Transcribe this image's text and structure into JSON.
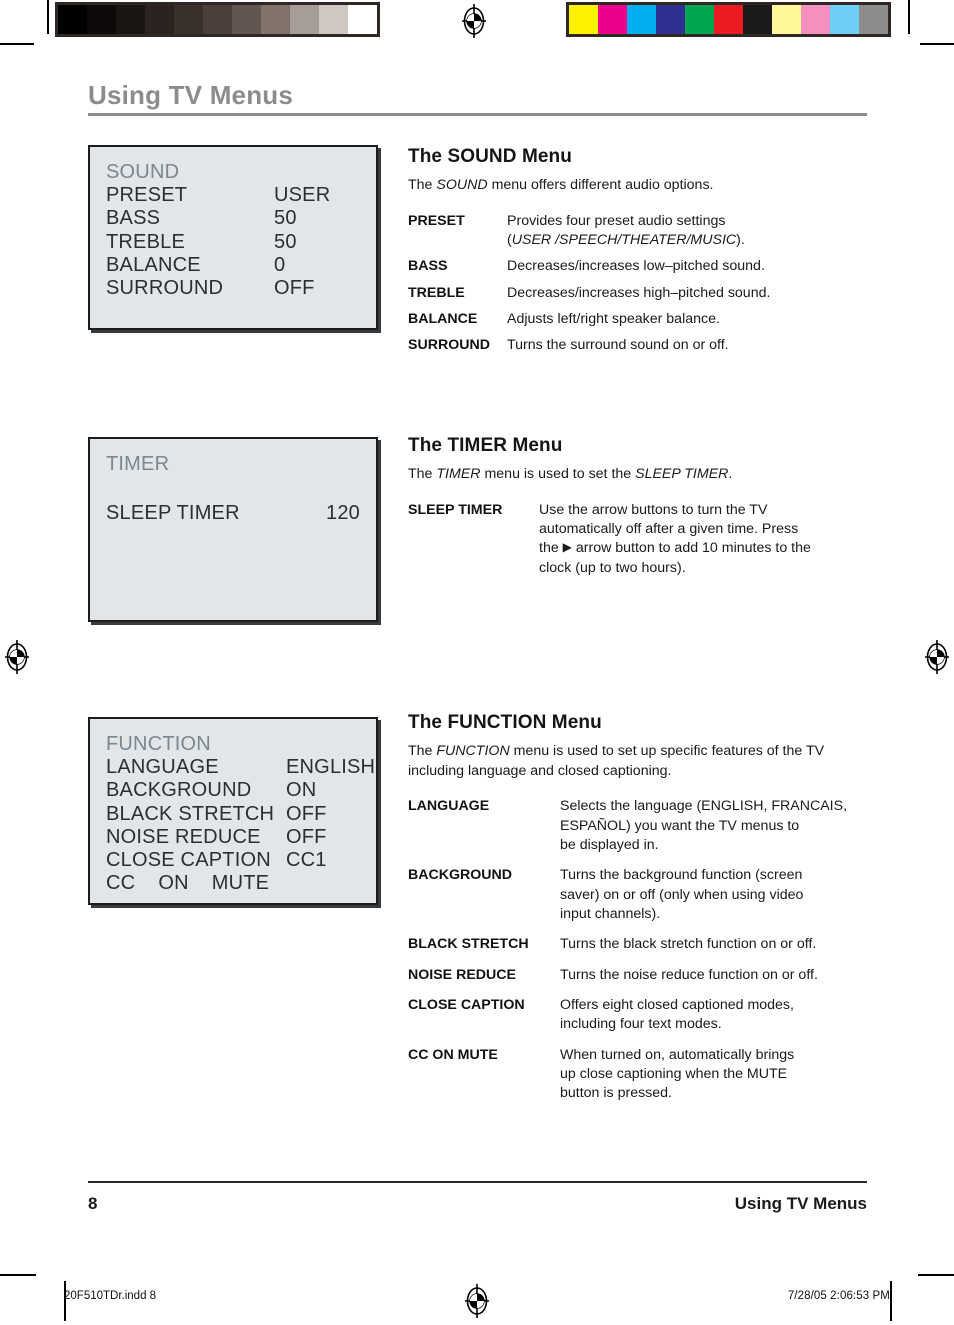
{
  "header": {
    "title": "Using TV Menus"
  },
  "prepress": {
    "grayscale_swatches": [
      "#000000",
      "#0d0a09",
      "#191513",
      "#2a2320",
      "#3a302c",
      "#4b3f3a",
      "#635651",
      "#81726c",
      "#a79d98",
      "#d0c7c2",
      "#ffffff"
    ],
    "color_swatches": [
      "#fff200",
      "#ec008c",
      "#00aeef",
      "#2e3192",
      "#00a651",
      "#ed1c24",
      "#1a1a1a",
      "#fff79a",
      "#f490bf",
      "#6dcff6",
      "#8c8c8c"
    ],
    "registration_mark": "registration-target-icon",
    "slug_left": "20F510TDr.indd   8",
    "slug_right": "7/28/05   2:06:53 PM"
  },
  "sections": [
    {
      "id": "sound",
      "osd": {
        "title": "SOUND",
        "rows": [
          {
            "label": "PRESET",
            "value": "USER"
          },
          {
            "label": "BASS",
            "value": "50"
          },
          {
            "label": "TREBLE",
            "value": "50"
          },
          {
            "label": "BALANCE",
            "value": "0"
          },
          {
            "label": "SURROUND",
            "value": "OFF"
          }
        ]
      },
      "heading": "The SOUND Menu",
      "intro_html": "The <em>SOUND</em> menu offers different audio options.",
      "definitions": [
        {
          "term": "PRESET",
          "desc_html": "Provides four preset audio settings<br>(<em>USER /SPEECH/THEATER/MUSIC</em>)."
        },
        {
          "term": "BASS",
          "desc_html": "Decreases/increases low–pitched sound."
        },
        {
          "term": "TREBLE",
          "desc_html": "Decreases/increases high–pitched sound."
        },
        {
          "term": "BALANCE",
          "desc_html": "Adjusts left/right speaker balance."
        },
        {
          "term": "SURROUND",
          "desc_html": "Turns the surround sound on or off."
        }
      ]
    },
    {
      "id": "timer",
      "osd": {
        "title": "TIMER",
        "rows": [
          {
            "label": "SLEEP TIMER",
            "value": "120"
          }
        ]
      },
      "heading": "The TIMER Menu",
      "intro_html": "The <em>TIMER</em> menu is used to set the <em>SLEEP TIMER</em>.",
      "definitions": [
        {
          "term": "SLEEP TIMER",
          "desc_html": "Use the arrow buttons to turn the TV<br>automatically off after a given time. Press<br>the <span class=\"tri-glyph\">▶</span> arrow button to add 10 minutes to the<br>clock (up to two hours)."
        }
      ]
    },
    {
      "id": "function",
      "osd": {
        "title": "FUNCTION",
        "rows": [
          {
            "label": "LANGUAGE",
            "value": "ENGLISH"
          },
          {
            "label": "BACKGROUND",
            "value": "ON"
          },
          {
            "label": "BLACK STRETCH",
            "value": "OFF"
          },
          {
            "label": "NOISE REDUCE",
            "value": "OFF"
          },
          {
            "label": "CLOSE CAPTION",
            "value": "CC1"
          },
          {
            "label": "CC    ON    MUTE",
            "value": ""
          }
        ]
      },
      "heading": "The FUNCTION Menu",
      "intro_html": "The <em>FUNCTION</em> menu is used to set up specific features of the TV including language and closed captioning.",
      "definitions": [
        {
          "term": "LANGUAGE",
          "desc_html": "Selects the language (ENGLISH, FRANCAIS,<br>ESPAÑOL) you want the TV menus to<br>be displayed in."
        },
        {
          "term": "BACKGROUND",
          "desc_html": "Turns the background function (screen<br>saver)  on or off (only when using video<br>input channels)."
        },
        {
          "term": "BLACK STRETCH",
          "desc_html": "Turns the black stretch function on or off."
        },
        {
          "term": "NOISE REDUCE",
          "desc_html": "Turns the noise reduce function on or off."
        },
        {
          "term": "CLOSE CAPTION",
          "desc_html": "Offers eight closed captioned modes,<br>including four text modes."
        },
        {
          "term": "CC ON MUTE",
          "desc_html": "When turned on, automatically brings<br>up close captioning when the MUTE<br>button is pressed."
        }
      ]
    }
  ],
  "footer": {
    "page_number": "8",
    "running_title": "Using TV Menus"
  }
}
